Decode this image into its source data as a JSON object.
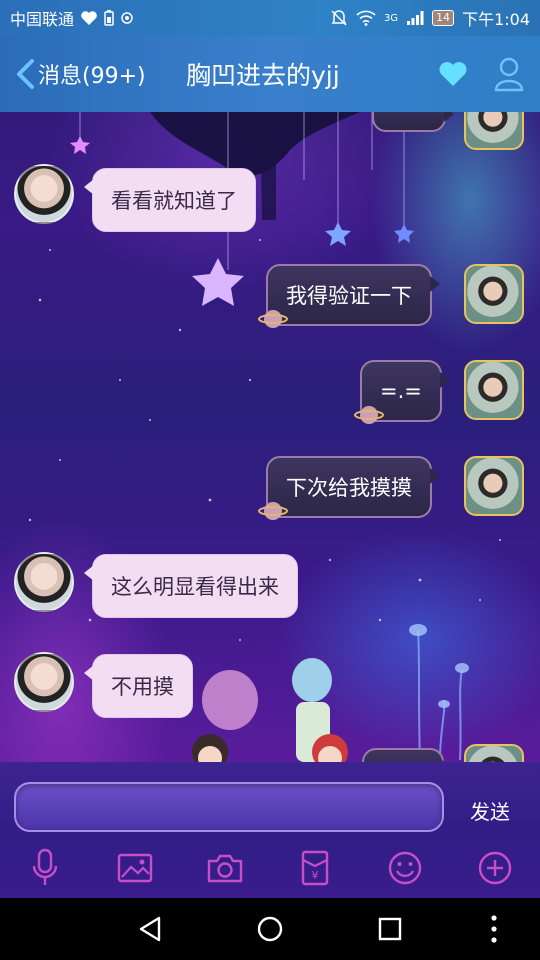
{
  "status_bar": {
    "carrier": "中国联通",
    "network": "3G",
    "battery": "14",
    "time": "下午1:04"
  },
  "header": {
    "back_label": "消息(99+)",
    "title": "胸凹进去的yjj"
  },
  "messages": [
    {
      "side": "in",
      "text": "看看就知道了"
    },
    {
      "side": "out",
      "text": "我得验证一下"
    },
    {
      "side": "out",
      "text": "=.="
    },
    {
      "side": "out",
      "text": "下次给我摸摸"
    },
    {
      "side": "in",
      "text": "这么明显看得出来"
    },
    {
      "side": "in",
      "text": "不用摸"
    }
  ],
  "input": {
    "send_label": "发送"
  },
  "toolbar": {
    "icons": [
      "microphone-icon",
      "image-icon",
      "camera-icon",
      "red-envelope-icon",
      "emoji-icon",
      "plus-icon"
    ]
  },
  "nav": {
    "icons": [
      "back-triangle-icon",
      "home-circle-icon",
      "recents-square-icon",
      "menu-dots-icon"
    ]
  }
}
